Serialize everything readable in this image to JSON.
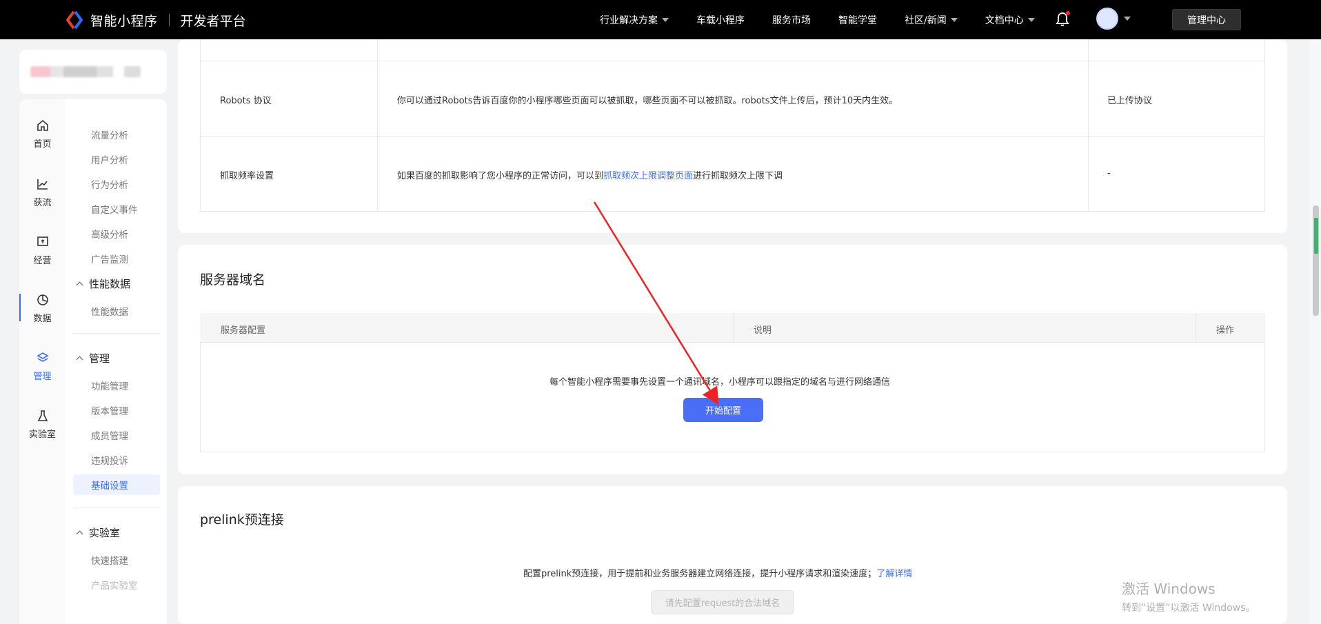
{
  "header": {
    "brand": "智能小程序",
    "brand_sub": "开发者平台",
    "nav": [
      {
        "label": "行业解决方案",
        "has_dropdown": true
      },
      {
        "label": "车载小程序",
        "has_dropdown": false
      },
      {
        "label": "服务市场",
        "has_dropdown": false
      },
      {
        "label": "智能学堂",
        "has_dropdown": false
      },
      {
        "label": "社区/新闻",
        "has_dropdown": true
      },
      {
        "label": "文档中心",
        "has_dropdown": true
      }
    ],
    "manage_button": "管理中心"
  },
  "rail": {
    "items": [
      {
        "label": "首页",
        "icon": "home-icon"
      },
      {
        "label": "获流",
        "icon": "chart-line-icon"
      },
      {
        "label": "经营",
        "icon": "monitor-icon"
      },
      {
        "label": "数据",
        "icon": "pie-chart-icon"
      },
      {
        "label": "管理",
        "icon": "layers-icon",
        "active": true
      },
      {
        "label": "实验室",
        "icon": "flask-icon"
      }
    ]
  },
  "menu": {
    "analysis": [
      "流量分析",
      "用户分析",
      "行为分析",
      "自定义事件",
      "高级分析",
      "广告监测"
    ],
    "perf_group": "性能数据",
    "perf_items": [
      "性能数据"
    ],
    "manage_group": "管理",
    "manage_items": [
      "功能管理",
      "版本管理",
      "成员管理",
      "违规投诉",
      "基础设置"
    ],
    "lab_group": "实验室",
    "lab_items": [
      "快速搭建",
      "产品实验室"
    ]
  },
  "robots_table": {
    "rows": [
      {
        "name": "Robots 协议",
        "desc": "你可以通过Robots告诉百度你的小程序哪些页面可以被抓取，哪些页面不可以被抓取。robots文件上传后，预计10天内生效。",
        "status": "已上传协议"
      },
      {
        "name": "抓取频率设置",
        "desc_prefix": "如果百度的抓取影响了您小程序的正常访问，可以到",
        "desc_link": "抓取频次上限调整页面",
        "desc_suffix": "进行抓取频次上限下调",
        "status": "-"
      }
    ]
  },
  "server_domain": {
    "title": "服务器域名",
    "columns": [
      "服务器配置",
      "说明",
      "操作"
    ],
    "empty_text": "每个智能小程序需要事先设置一个通讯域名，小程序可以跟指定的域名与进行网络通信",
    "start_button": "开始配置"
  },
  "prelink": {
    "title": "prelink预连接",
    "desc": "配置prelink预连接，用于提前和业务服务器建立网络连接，提升小程序请求和渲染速度；",
    "link": "了解详情",
    "disabled_button": "请先配置request的合法域名"
  },
  "watermark": {
    "line1": "激活 Windows",
    "line2": "转到“设置”以激活 Windows。"
  },
  "colors": {
    "accent": "#3c6ef5",
    "arrow": "#ee2222"
  }
}
